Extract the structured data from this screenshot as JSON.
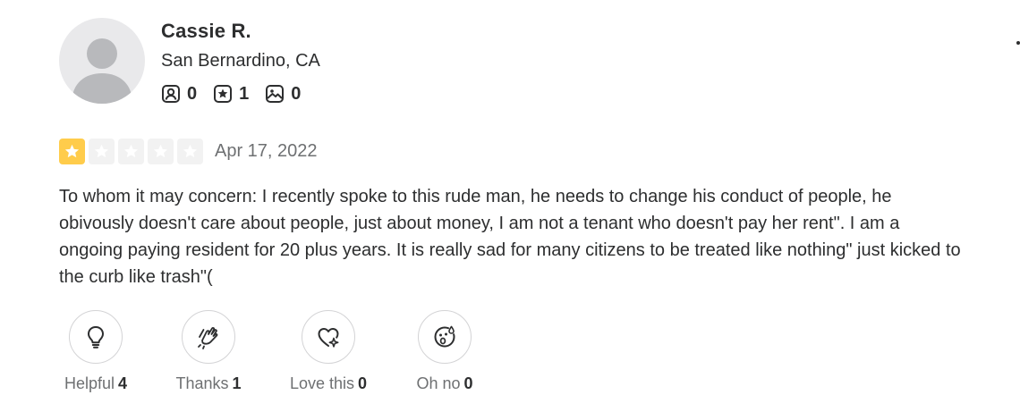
{
  "reviewer": {
    "name": "Cassie R.",
    "location": "San Bernardino, CA",
    "stats": {
      "friends": "0",
      "reviews": "1",
      "photos": "0"
    },
    "avatar_icon": "default-user-silhouette"
  },
  "rating": {
    "value": 1,
    "max": 5,
    "date": "Apr 17, 2022",
    "color_filled": "#ffcc4b",
    "color_empty": "#f2f2f2"
  },
  "review_text": "To whom it may concern: I recently spoke to this rude man, he needs to change his conduct of people, he obivously doesn't care about people, just about money, I am not a tenant who doesn't pay her rent\". I am a ongoing paying resident for 20 plus years. It is really sad for many citizens to be treated like nothing\" just kicked to the curb like trash\"(",
  "reactions": [
    {
      "label": "Helpful",
      "count": "4",
      "icon": "lightbulb-icon"
    },
    {
      "label": "Thanks",
      "count": "1",
      "icon": "clapping-hands-icon"
    },
    {
      "label": "Love this",
      "count": "0",
      "icon": "heart-sparkle-icon"
    },
    {
      "label": "Oh no",
      "count": "0",
      "icon": "surprised-face-icon"
    }
  ]
}
